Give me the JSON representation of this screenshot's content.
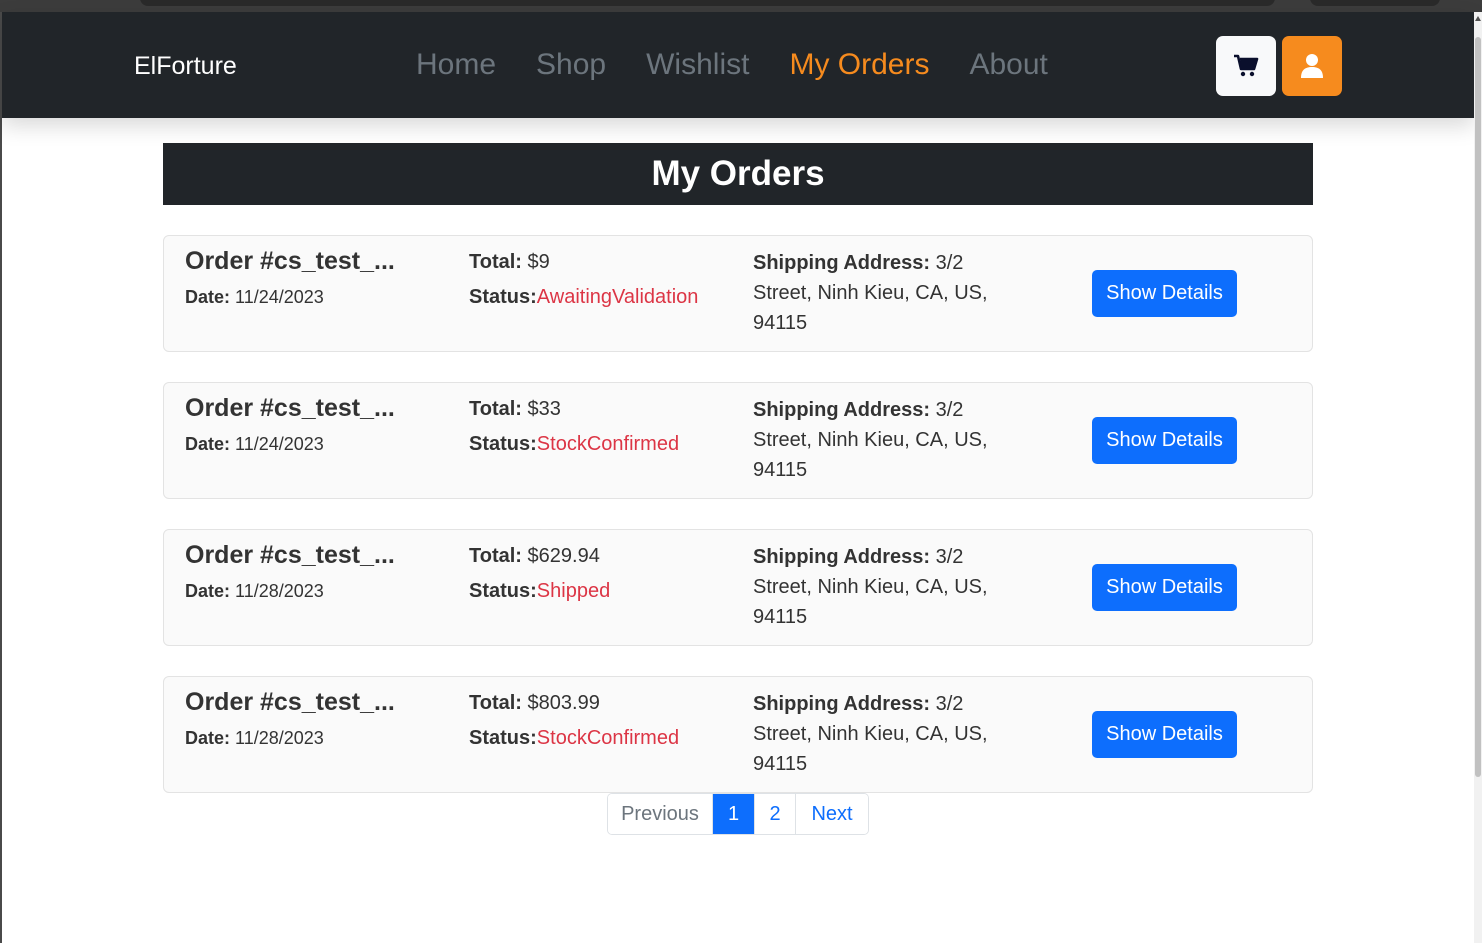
{
  "navbar": {
    "brand": "ElForture",
    "links": [
      {
        "label": "Home",
        "active": false
      },
      {
        "label": "Shop",
        "active": false
      },
      {
        "label": "Wishlist",
        "active": false
      },
      {
        "label": "My Orders",
        "active": true
      },
      {
        "label": "About",
        "active": false
      }
    ],
    "cart_icon": "cart-icon",
    "user_icon": "user-icon"
  },
  "colors": {
    "accent": "#f68b1e",
    "primary": "#0d6efd",
    "dark": "#212529",
    "status": "#dc3545"
  },
  "page": {
    "title": "My Orders"
  },
  "labels": {
    "total": "Total:",
    "status": "Status:",
    "date": "Date:",
    "shipping": "Shipping Address:",
    "details_button": "Show Details"
  },
  "orders": [
    {
      "id": "Order #cs_test_...",
      "date": "11/24/2023",
      "total": "$9",
      "status": "AwaitingValidation",
      "address_first": "3/2",
      "address_rest": "Street, Ninh Kieu, CA, US, 94115"
    },
    {
      "id": "Order #cs_test_...",
      "date": "11/24/2023",
      "total": "$33",
      "status": "StockConfirmed",
      "address_first": "3/2",
      "address_rest": "Street, Ninh Kieu, CA, US, 94115"
    },
    {
      "id": "Order #cs_test_...",
      "date": "11/28/2023",
      "total": "$629.94",
      "status": "Shipped",
      "address_first": "3/2",
      "address_rest": "Street, Ninh Kieu, CA, US, 94115"
    },
    {
      "id": "Order #cs_test_...",
      "date": "11/28/2023",
      "total": "$803.99",
      "status": "StockConfirmed",
      "address_first": "3/2",
      "address_rest": "Street, Ninh Kieu, CA, US, 94115"
    }
  ],
  "pagination": {
    "previous": "Previous",
    "pages": [
      "1",
      "2"
    ],
    "current": "1",
    "next": "Next"
  }
}
